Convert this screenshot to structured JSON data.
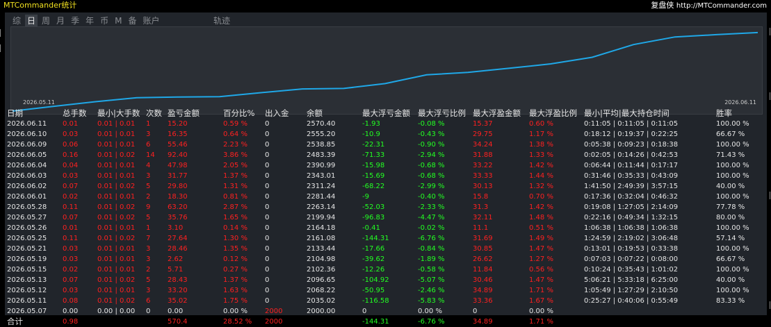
{
  "app_title": "MTCommander统计",
  "brand": {
    "name": "复盘侠",
    "url": "http://MTCommander.com"
  },
  "tabs": [
    {
      "label": "综",
      "active": false
    },
    {
      "label": "日",
      "active": true
    },
    {
      "label": "周",
      "active": false
    },
    {
      "label": "月",
      "active": false
    },
    {
      "label": "季",
      "active": false
    },
    {
      "label": "年",
      "active": false
    },
    {
      "label": "币",
      "active": false
    },
    {
      "label": "M",
      "active": false
    },
    {
      "label": "备",
      "active": false
    },
    {
      "label": "账户",
      "active": false
    }
  ],
  "trail_label": "轨迹",
  "chart_data": {
    "type": "line",
    "x_start_label": "2026.05.11",
    "x_end_label": "2026.06.11",
    "ylim": [
      2000,
      2580
    ],
    "series": [
      {
        "values": [
          2000.0,
          2035.02,
          2068.22,
          2096.65,
          2102.36,
          2104.98,
          2133.44,
          2161.08,
          2164.18,
          2199.94,
          2263.14,
          2281.44,
          2311.24,
          2343.01,
          2390.99,
          2483.39,
          2538.85,
          2555.2,
          2570.4
        ]
      }
    ],
    "color": "#1fa8e8"
  },
  "table": {
    "headers": [
      "日期",
      "总手数",
      "最小|大手数",
      "次数",
      "盈亏金额",
      "百分比%",
      "出入金",
      "余额",
      "最大浮亏金额",
      "最大浮亏比例",
      "最大浮盈金额",
      "最大浮盈比例",
      "最小|平均|最大持仓时间",
      "胜率"
    ],
    "rows": [
      [
        "2026.06.11",
        "0.01",
        "0.01 | 0.01",
        "1",
        "15.20",
        "0.59 %",
        "0",
        "2570.40",
        "-1.93",
        "-0.08 %",
        "15.37",
        "0.60 %",
        "0:11:05 | 0:11:05 | 0:11:05",
        "100.00 %"
      ],
      [
        "2026.06.10",
        "0.03",
        "0.01 | 0.01",
        "3",
        "16.35",
        "0.64 %",
        "0",
        "2555.20",
        "-10.9",
        "-0.43 %",
        "29.75",
        "1.17 %",
        "0:18:12 | 0:19:37 | 0:22:25",
        "66.67 %"
      ],
      [
        "2026.06.09",
        "0.06",
        "0.01 | 0.01",
        "6",
        "55.46",
        "2.23 %",
        "0",
        "2538.85",
        "-22.31",
        "-0.90 %",
        "34.24",
        "1.38 %",
        "0:05:38 | 0:09:23 | 0:18:38",
        "100.00 %"
      ],
      [
        "2026.06.05",
        "0.16",
        "0.01 | 0.02",
        "14",
        "92.40",
        "3.86 %",
        "0",
        "2483.39",
        "-71.33",
        "-2.94 %",
        "31.88",
        "1.33 %",
        "0:02:05 | 0:14:26 | 0:42:53",
        "71.43 %"
      ],
      [
        "2026.06.04",
        "0.04",
        "0.01 | 0.01",
        "4",
        "47.98",
        "2.05 %",
        "0",
        "2390.99",
        "-15.98",
        "-0.68 %",
        "33.22",
        "1.42 %",
        "0:06:44 | 0:11:44 | 0:17:17",
        "100.00 %"
      ],
      [
        "2026.06.03",
        "0.03",
        "0.01 | 0.01",
        "3",
        "31.77",
        "1.37 %",
        "0",
        "2343.01",
        "-15.69",
        "-0.68 %",
        "33.33",
        "1.44 %",
        "0:31:46 | 0:35:33 | 0:43:09",
        "100.00 %"
      ],
      [
        "2026.06.02",
        "0.07",
        "0.01 | 0.02",
        "5",
        "29.80",
        "1.31 %",
        "0",
        "2311.24",
        "-68.22",
        "-2.99 %",
        "30.13",
        "1.32 %",
        "1:41:50 | 2:49:39 | 3:57:15",
        "40.00 %"
      ],
      [
        "2026.06.01",
        "0.02",
        "0.01 | 0.01",
        "2",
        "18.30",
        "0.81 %",
        "0",
        "2281.44",
        "-9",
        "-0.40 %",
        "15.8",
        "0.70 %",
        "0:17:36 | 0:32:04 | 0:46:32",
        "100.00 %"
      ],
      [
        "2026.05.28",
        "0.11",
        "0.01 | 0.02",
        "9",
        "63.20",
        "2.87 %",
        "0",
        "2263.14",
        "-52.03",
        "-2.33 %",
        "31.3",
        "1.42 %",
        "0:19:08 | 1:27:05 | 2:14:09",
        "77.78 %"
      ],
      [
        "2026.05.27",
        "0.07",
        "0.01 | 0.02",
        "5",
        "35.76",
        "1.65 %",
        "0",
        "2199.94",
        "-96.83",
        "-4.47 %",
        "32.11",
        "1.48 %",
        "0:22:16 | 0:49:34 | 1:32:15",
        "80.00 %"
      ],
      [
        "2026.05.26",
        "0.01",
        "0.01 | 0.01",
        "1",
        "3.10",
        "0.14 %",
        "0",
        "2164.18",
        "-0.41",
        "-0.02 %",
        "11.1",
        "0.51 %",
        "1:06:38 | 1:06:38 | 1:06:38",
        "100.00 %"
      ],
      [
        "2026.05.25",
        "0.11",
        "0.01 | 0.02",
        "7",
        "27.64",
        "1.30 %",
        "0",
        "2161.08",
        "-144.31",
        "-6.76 %",
        "31.69",
        "1.49 %",
        "1:24:59 | 2:19:02 | 3:06:48",
        "57.14 %"
      ],
      [
        "2026.05.21",
        "0.03",
        "0.01 | 0.01",
        "3",
        "28.46",
        "1.35 %",
        "0",
        "2133.44",
        "-17.66",
        "-0.84 %",
        "30.85",
        "1.47 %",
        "0:13:01 | 0:19:53 | 0:33:38",
        "100.00 %"
      ],
      [
        "2026.05.19",
        "0.03",
        "0.01 | 0.01",
        "3",
        "2.62",
        "0.12 %",
        "0",
        "2104.98",
        "-39.62",
        "-1.89 %",
        "26.62",
        "1.27 %",
        "0:07:03 | 0:07:22 | 0:08:00",
        "66.67 %"
      ],
      [
        "2026.05.15",
        "0.02",
        "0.01 | 0.01",
        "2",
        "5.71",
        "0.27 %",
        "0",
        "2102.36",
        "-12.26",
        "-0.58 %",
        "11.84",
        "0.56 %",
        "0:10:24 | 0:35:43 | 1:01:02",
        "100.00 %"
      ],
      [
        "2026.05.13",
        "0.07",
        "0.01 | 0.02",
        "5",
        "28.43",
        "1.37 %",
        "0",
        "2096.65",
        "-104.92",
        "-5.07 %",
        "30.46",
        "1.47 %",
        "5:06:21 | 5:33:18 | 6:25:00",
        "40.00 %"
      ],
      [
        "2026.05.12",
        "0.03",
        "0.01 | 0.01",
        "3",
        "33.20",
        "1.63 %",
        "0",
        "2068.22",
        "-50.95",
        "-2.46 %",
        "34.89",
        "1.71 %",
        "1:05:49 | 1:27:29 | 2:10:50",
        "100.00 %"
      ],
      [
        "2026.05.11",
        "0.08",
        "0.01 | 0.02",
        "6",
        "35.02",
        "1.75 %",
        "0",
        "2035.02",
        "-116.58",
        "-5.83 %",
        "33.36",
        "1.67 %",
        "0:25:27 | 0:40:06 | 0:55:49",
        "83.33 %"
      ],
      [
        "2026.05.07",
        "0.00",
        "0.00 | 0.00",
        "0",
        "0.00",
        "0.00 %",
        "2000",
        "2000.00",
        "0",
        "0.00 %",
        "0",
        "0.00 %",
        "",
        ""
      ]
    ],
    "total": [
      "合计",
      "0.98",
      "",
      "",
      "570.4",
      "28.52 %",
      "2000",
      "",
      "-144.31",
      "-6.76 %",
      "34.89",
      "1.71 %",
      "",
      ""
    ]
  }
}
